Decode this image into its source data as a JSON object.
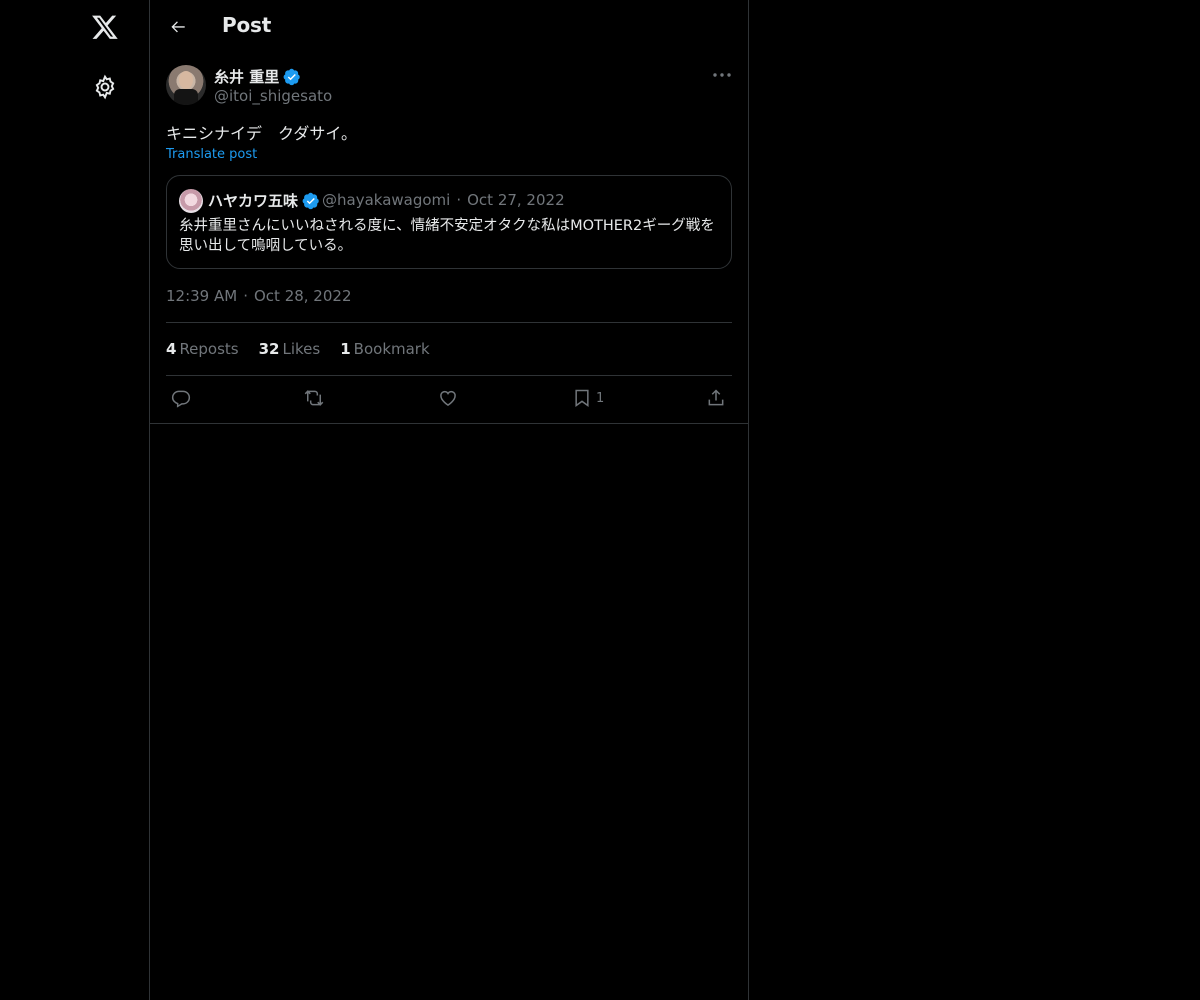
{
  "header": {
    "title": "Post"
  },
  "post": {
    "author_name": "糸井 重里",
    "author_handle": "@itoi_shigesato",
    "text": "キニシナイデ　クダサイ。",
    "translate_label": "Translate post",
    "time": "12:39 AM",
    "date": "Oct 28, 2022"
  },
  "quote": {
    "author_name": "ハヤカワ五味",
    "author_handle": "@hayakawagomi",
    "date": "Oct 27, 2022",
    "text": "糸井重里さんにいいねされる度に、情緒不安定オタクな私はMOTHER2ギーグ戦を思い出して嗚咽している。"
  },
  "stats": {
    "reposts_count": "4",
    "reposts_label": "Reposts",
    "likes_count": "32",
    "likes_label": "Likes",
    "bookmarks_count": "1",
    "bookmarks_label": "Bookmark"
  },
  "actions": {
    "bookmark_count": "1"
  },
  "colors": {
    "accent": "#1d9bf0",
    "background": "#000000",
    "muted": "#71767b",
    "border": "#2f3336"
  },
  "icons": [
    "x-logo-icon",
    "settings-icon",
    "back-arrow-icon",
    "verified-icon",
    "more-icon",
    "reply-icon",
    "repost-icon",
    "like-icon",
    "bookmark-icon",
    "share-icon"
  ]
}
